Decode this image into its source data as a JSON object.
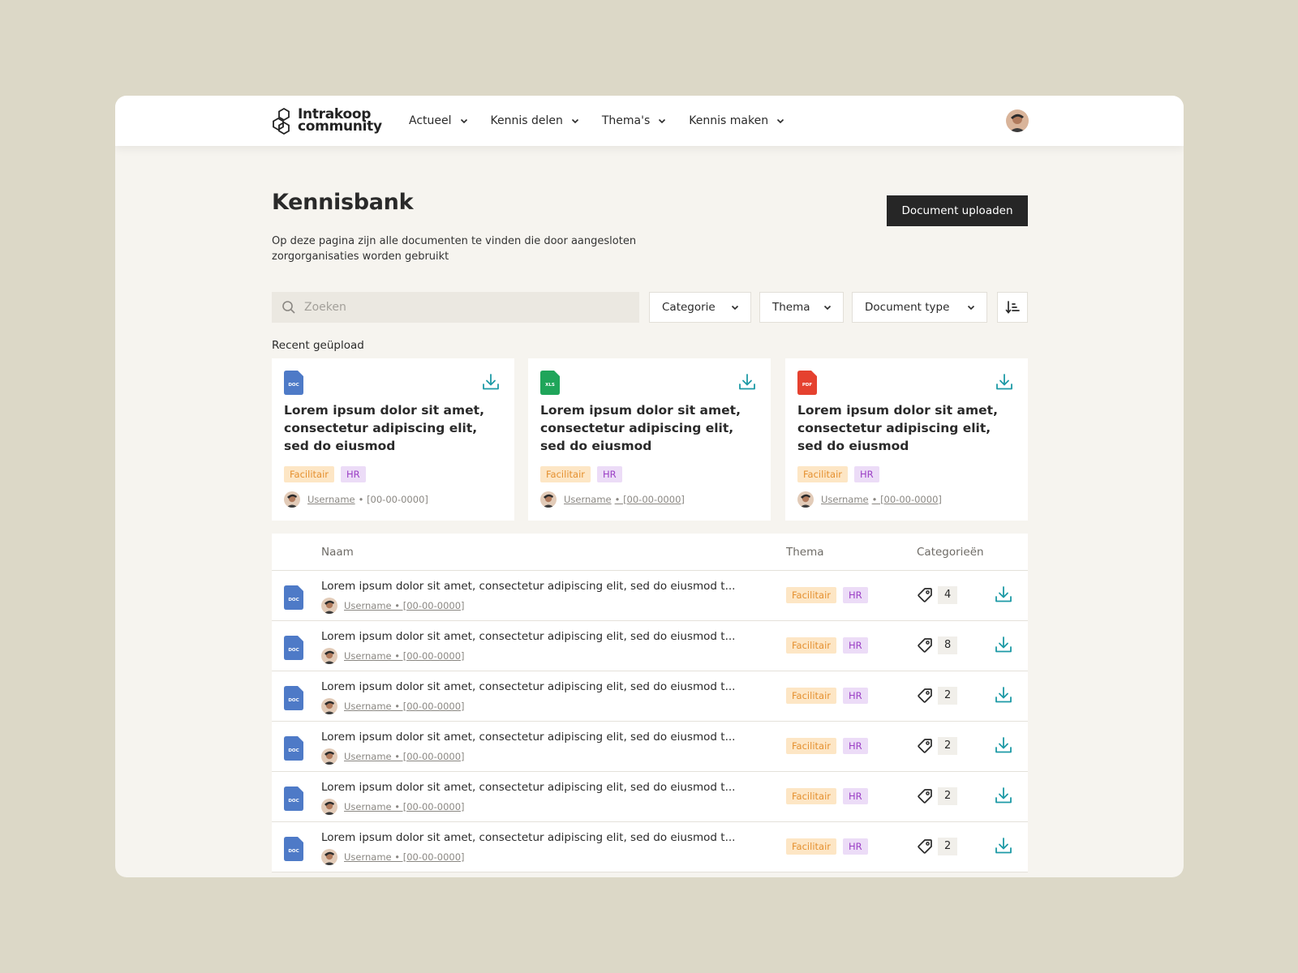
{
  "brand": {
    "line1": "Intrakoop",
    "line2": "community"
  },
  "nav": [
    {
      "label": "Actueel"
    },
    {
      "label": "Kennis delen"
    },
    {
      "label": "Thema's"
    },
    {
      "label": "Kennis maken"
    }
  ],
  "page": {
    "title": "Kennisbank",
    "description": "Op deze pagina zijn alle documenten te vinden die door aangesloten zorgorganisaties worden gebruikt",
    "upload_label": "Document uploaden"
  },
  "search": {
    "placeholder": "Zoeken"
  },
  "filters": {
    "categorie": "Categorie",
    "thema": "Thema",
    "document_type": "Document type"
  },
  "recent": {
    "label": "Recent geüpload",
    "cards": [
      {
        "type": "DOC",
        "title": "Lorem ipsum dolor sit amet, consectetur adipiscing elit, sed do eiusmod",
        "tags": [
          "Facilitair",
          "HR"
        ],
        "user": "Username",
        "date": "• [00-00-0000]"
      },
      {
        "type": "XLS",
        "title": "Lorem ipsum dolor sit amet, consectetur adipiscing elit, sed do eiusmod",
        "tags": [
          "Facilitair",
          "HR"
        ],
        "user": "Username",
        "date": "• [00-00-0000]"
      },
      {
        "type": "PDF",
        "title": "Lorem ipsum dolor sit amet, consectetur adipiscing elit, sed do eiusmod",
        "tags": [
          "Facilitair",
          "HR"
        ],
        "user": "Username",
        "date": "• [00-00-0000]"
      }
    ]
  },
  "table": {
    "headers": {
      "naam": "Naam",
      "thema": "Thema",
      "categorieen": "Categorieën"
    },
    "rows": [
      {
        "type": "DOC",
        "title": "Lorem ipsum dolor sit amet, consectetur adipiscing elit, sed do eiusmod t...",
        "meta": "Username • [00-00-0000]",
        "tags": [
          "Facilitair",
          "HR"
        ],
        "count": "4"
      },
      {
        "type": "DOC",
        "title": "Lorem ipsum dolor sit amet, consectetur adipiscing elit, sed do eiusmod t...",
        "meta": "Username • [00-00-0000]",
        "tags": [
          "Facilitair",
          "HR"
        ],
        "count": "8"
      },
      {
        "type": "DOC",
        "title": "Lorem ipsum dolor sit amet, consectetur adipiscing elit, sed do eiusmod t...",
        "meta": "Username • [00-00-0000]",
        "tags": [
          "Facilitair",
          "HR"
        ],
        "count": "2"
      },
      {
        "type": "DOC",
        "title": "Lorem ipsum dolor sit amet, consectetur adipiscing elit, sed do eiusmod t...",
        "meta": "Username • [00-00-0000]",
        "tags": [
          "Facilitair",
          "HR"
        ],
        "count": "2"
      },
      {
        "type": "DOC",
        "title": "Lorem ipsum dolor sit amet, consectetur adipiscing elit, sed do eiusmod t...",
        "meta": "Username • [00-00-0000]",
        "tags": [
          "Facilitair",
          "HR"
        ],
        "count": "2"
      },
      {
        "type": "DOC",
        "title": "Lorem ipsum dolor sit amet, consectetur adipiscing elit, sed do eiusmod t...",
        "meta": "Username • [00-00-0000]",
        "tags": [
          "Facilitair",
          "HR"
        ],
        "count": "2"
      }
    ]
  },
  "colors": {
    "doc": "#4e7ac7",
    "xls": "#1fa55a",
    "pdf": "#e5412f",
    "accent_download": "#1d9aa6",
    "upload_button": "#262626",
    "tag_facilitair_bg": "#fde6c5",
    "tag_hr_bg": "#ecdcf7"
  },
  "icons": {
    "search": "search-icon",
    "chevron": "chevron-down-icon",
    "sort": "sort-icon",
    "download": "download-icon",
    "tag": "tag-icon",
    "file": "file-icon"
  }
}
